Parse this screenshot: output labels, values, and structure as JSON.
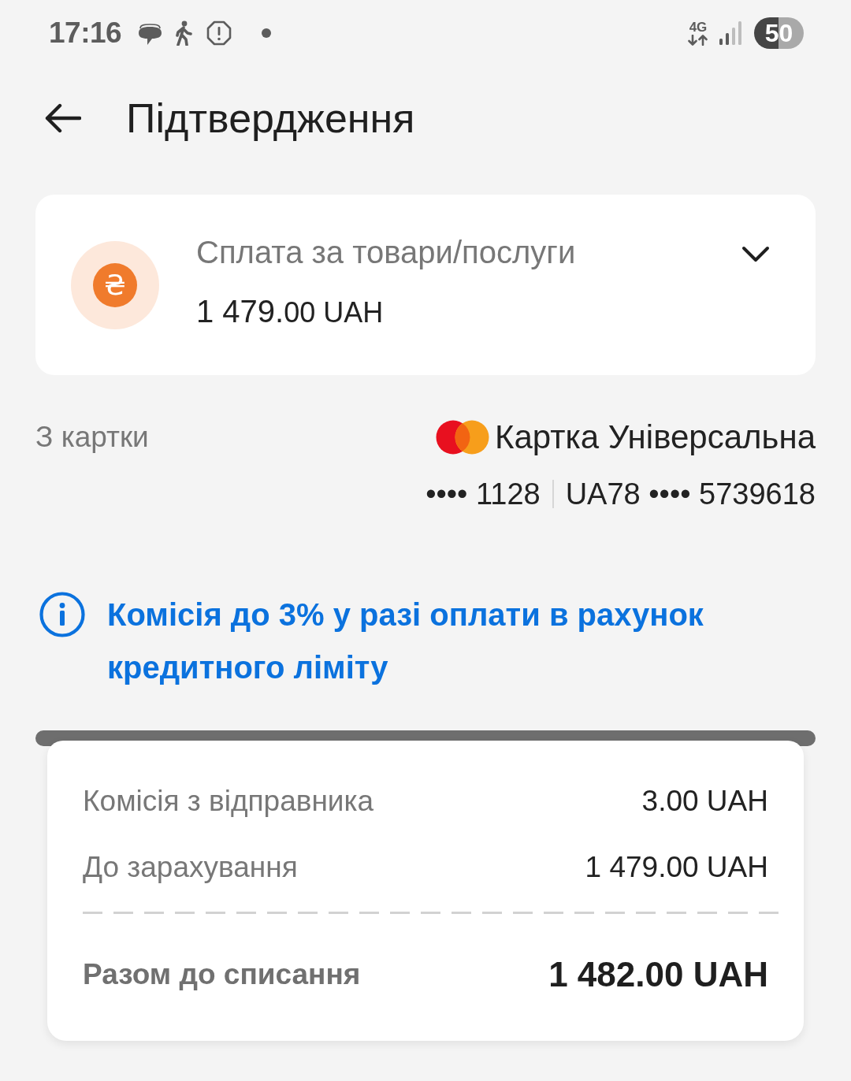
{
  "status_bar": {
    "time": "17:16",
    "network": "4G",
    "battery": "50"
  },
  "header": {
    "title": "Підтвердження"
  },
  "payment": {
    "title": "Сплата за товари/послуги",
    "currency_symbol": "₴",
    "amount_whole": "1 479.",
    "amount_fraction": "00 UAH",
    "expanded": false
  },
  "source": {
    "label": "З картки",
    "card_name": "Картка Універсальна",
    "card_number": "•••• 1128",
    "account": "UA78 •••• 5739618"
  },
  "notice": {
    "text": "Комісія до 3% у разі оплати в рахунок кредитного ліміту"
  },
  "summary": {
    "rows": [
      {
        "label": "Комісія з відправника",
        "value": "3.00 UAH"
      },
      {
        "label": "До зарахування",
        "value": "1 479.00 UAH"
      }
    ],
    "total": {
      "label": "Разом до списання",
      "value": "1 482.00 UAH"
    }
  }
}
